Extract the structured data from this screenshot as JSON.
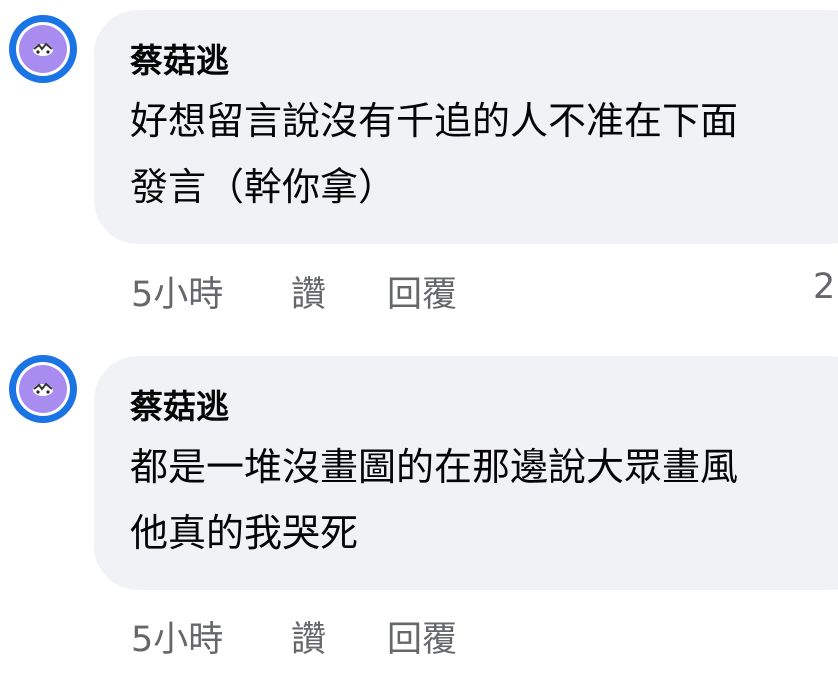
{
  "comments": [
    {
      "author": "蔡菇逃",
      "line1": "好想留言說沒有千追的人不准在下面",
      "line2": "發言（幹你拿）",
      "time": "5小時",
      "like_label": "讚",
      "reply_label": "回覆",
      "reaction_count": "2",
      "avatar_icon": "avatar-icon"
    },
    {
      "author": "蔡菇逃",
      "line1": "都是一堆沒畫圖的在那邊說大眾畫風",
      "line2": "他真的我哭死",
      "time": "5小時",
      "like_label": "讚",
      "reply_label": "回覆",
      "avatar_icon": "avatar-icon"
    }
  ],
  "colors": {
    "avatar_ring": "#1b74e4",
    "avatar_fill": "#a88cf0",
    "bubble": "#f0f2f5",
    "meta_text": "#65676b"
  }
}
